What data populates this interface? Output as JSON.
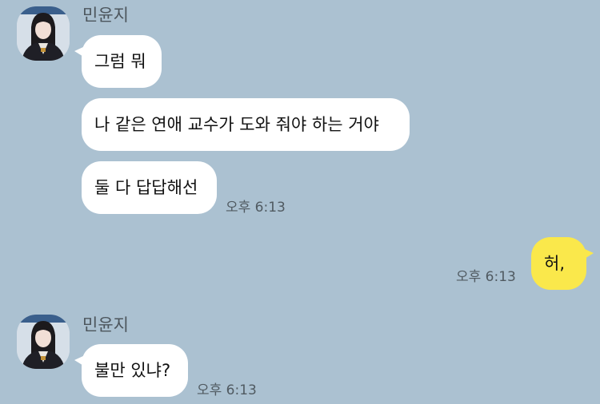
{
  "chat": {
    "messages": [
      {
        "sender": "민윤지",
        "avatar_icon": "profile-photo-icon",
        "bubbles": [
          {
            "text": "그럼 뭐"
          },
          {
            "text": "나 같은 연애 교수가 도와 줘야 하는 거야"
          },
          {
            "text": "둘 다 답답해선"
          }
        ],
        "time": "오후 6:13"
      },
      {
        "sender": "me",
        "bubbles": [
          {
            "text": "허,"
          }
        ],
        "time": "오후 6:13"
      },
      {
        "sender": "민윤지",
        "avatar_icon": "profile-photo-icon",
        "bubbles": [
          {
            "text": "불만 있냐?"
          }
        ],
        "time": "오후 6:13"
      }
    ]
  },
  "colors": {
    "background": "#abc1d1",
    "incoming_bubble": "#ffffff",
    "outgoing_bubble": "#fae84b"
  }
}
